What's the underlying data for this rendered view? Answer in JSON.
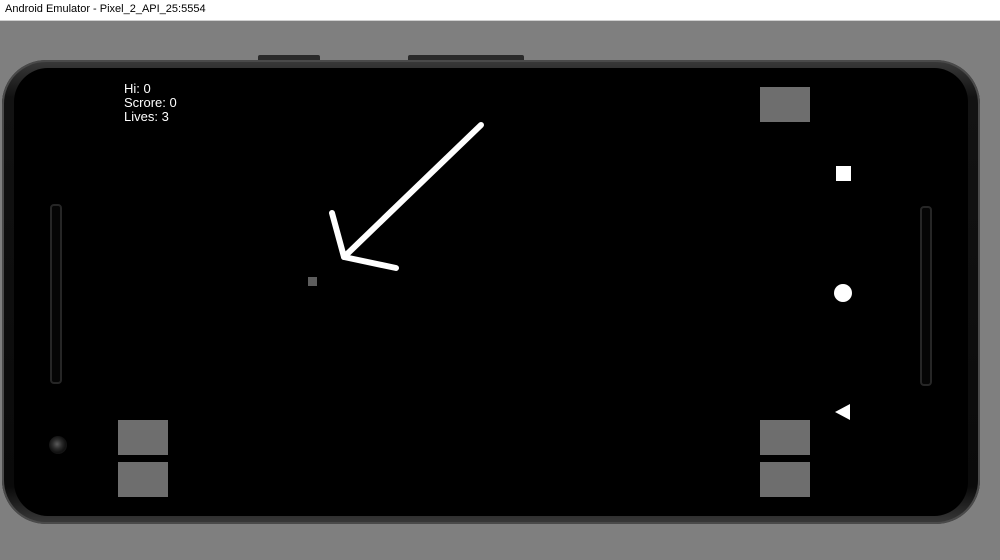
{
  "window": {
    "title": "Android Emulator - Pixel_2_API_25:5554"
  },
  "hud": {
    "hi": "Hi: 0",
    "score": "Scrore: 0",
    "lives": "Lives: 3"
  },
  "controls": {
    "color": "#6e6e6e"
  },
  "game": {
    "ball_color": "#5d5d5d",
    "annotation": "white-arrow-pointing-to-ball"
  },
  "nav": {
    "recent": "square-icon",
    "home": "circle-icon",
    "back": "triangle-back-icon"
  }
}
